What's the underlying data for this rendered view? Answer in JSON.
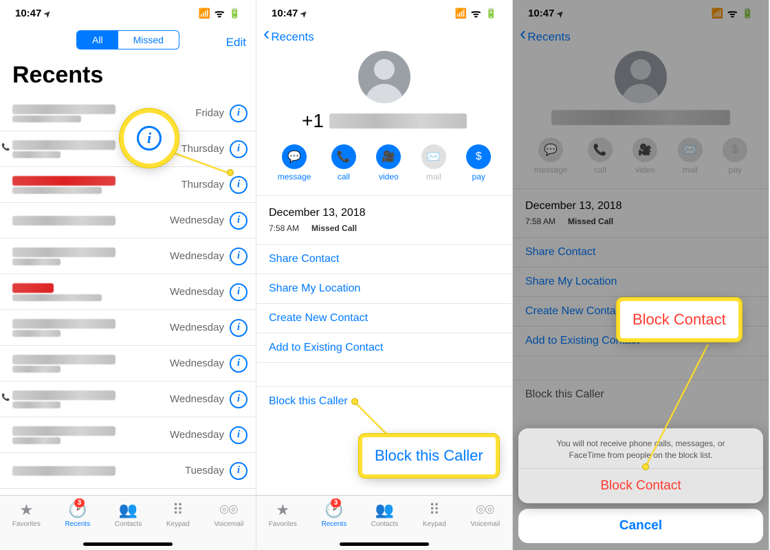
{
  "status": {
    "time": "10:47"
  },
  "s1": {
    "seg_all": "All",
    "seg_missed": "Missed",
    "edit": "Edit",
    "title": "Recents",
    "rows": [
      {
        "day": "Friday"
      },
      {
        "day": "Thursday"
      },
      {
        "day": "Thursday"
      },
      {
        "day": "Wednesday"
      },
      {
        "day": "Wednesday"
      },
      {
        "day": "Wednesday"
      },
      {
        "day": "Wednesday"
      },
      {
        "day": "Wednesday"
      },
      {
        "day": "Wednesday"
      },
      {
        "day": "Wednesday"
      },
      {
        "day": "Tuesday"
      }
    ]
  },
  "tabs": {
    "favorites": "Favorites",
    "recents": "Recents",
    "contacts": "Contacts",
    "keypad": "Keypad",
    "voicemail": "Voicemail",
    "badge": "3"
  },
  "detail": {
    "back": "Recents",
    "prefix": "+1",
    "actions": {
      "message": "message",
      "call": "call",
      "video": "video",
      "mail": "mail",
      "pay": "pay"
    },
    "date": "December 13, 2018",
    "time": "7:58 AM",
    "status": "Missed Call",
    "share_contact": "Share Contact",
    "share_loc": "Share My Location",
    "create": "Create New Contact",
    "add": "Add to Existing Contact",
    "block": "Block this Caller"
  },
  "sheet": {
    "msg": "You will not receive phone calls, messages, or FaceTime from people on the block list.",
    "block": "Block Contact",
    "cancel": "Cancel"
  },
  "callout": {
    "info": "i",
    "block_caller": "Block this Caller",
    "block_contact": "Block Contact"
  }
}
